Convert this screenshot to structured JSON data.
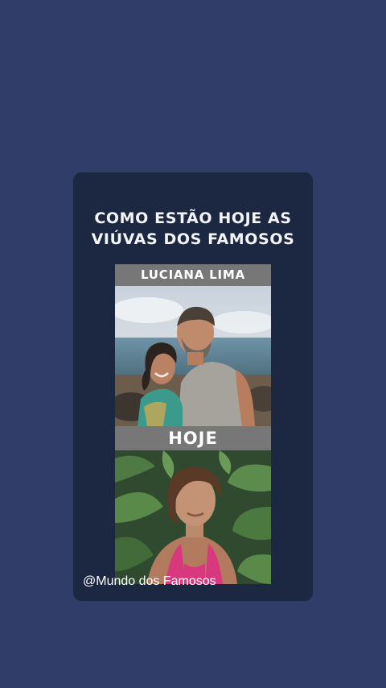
{
  "card": {
    "title_line1": "COMO ESTÃO HOJE AS",
    "title_line2": "VIÚVAS DOS FAMOSOS"
  },
  "photos": {
    "name_label": "LUCIANA LIMA",
    "today_label": "HOJE"
  },
  "watermark": {
    "handle": "@Mundo dos Famosos"
  },
  "colors": {
    "page_background": "#303d69",
    "card_background": "#1c2741",
    "label_bar": "#777777",
    "text": "#ffffff"
  }
}
